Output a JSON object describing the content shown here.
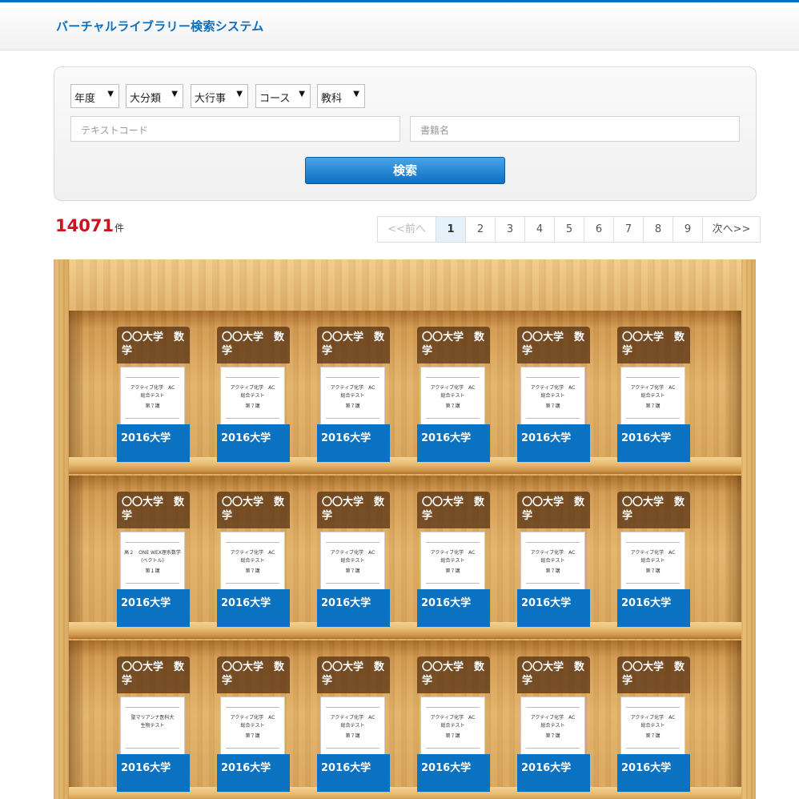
{
  "header": {
    "title": "バーチャルライブラリー検索システム"
  },
  "search": {
    "selects": [
      {
        "value": "年度"
      },
      {
        "value": "大分類"
      },
      {
        "value": "大行事"
      },
      {
        "value": "コース"
      },
      {
        "value": "教科"
      }
    ],
    "text_code_placeholder": "テキストコード",
    "book_name_placeholder": "書籍名",
    "button_label": "検索"
  },
  "results": {
    "count": "14071",
    "unit": "件"
  },
  "pagination": {
    "prev": "<<前へ",
    "pages": [
      "1",
      "2",
      "3",
      "4",
      "5",
      "6",
      "7",
      "8",
      "9"
    ],
    "active_page": "1",
    "next": "次へ>>"
  },
  "books": {
    "tag_text": "〇〇大学　数学",
    "label_text": "2016大学",
    "cover_default": {
      "line1": "アクティブ化学　AC",
      "line2": "総合テスト",
      "line3": "第７講"
    },
    "cover_row2_first": {
      "line1": "高２　ONE WEX理系数学",
      "line2": "(ベクトル)",
      "line3": "第１講"
    },
    "cover_row3_first": {
      "line1": "聖マリアンナ医科大",
      "line2": "生物テスト",
      "line3": ""
    }
  },
  "colors": {
    "brand_blue": "#0a6fbf",
    "count_red": "#c8141e",
    "book_label_blue": "#0a72c0"
  }
}
